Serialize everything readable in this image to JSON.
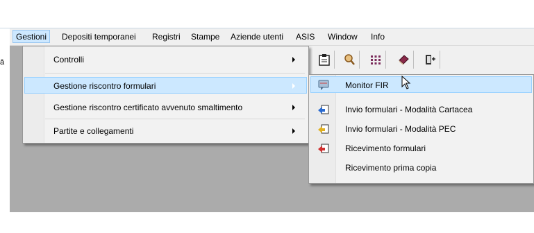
{
  "menubar": {
    "items": [
      {
        "label": "Gestioni"
      },
      {
        "label": "Depositi temporanei"
      },
      {
        "label": "Registri"
      },
      {
        "label": "Stampe"
      },
      {
        "label": "Aziende utenti"
      },
      {
        "label": "ASIS"
      },
      {
        "label": "Window"
      },
      {
        "label": "Info"
      }
    ]
  },
  "left_glyph": "ā",
  "menu": {
    "items": [
      {
        "label": "Controlli",
        "submenu": true
      },
      {
        "label": "Gestione riscontro formulari",
        "submenu": true,
        "highlighted": true
      },
      {
        "label": "Gestione riscontro certificato avvenuto smaltimento",
        "submenu": true
      },
      {
        "label": "Partite e collegamenti",
        "submenu": true
      }
    ]
  },
  "submenu": {
    "items": [
      {
        "label": "Monitor FIR",
        "icon": "monitor-chat-icon",
        "highlighted": true
      },
      {
        "label": "Invio formulari - Modalità Cartacea",
        "icon": "send-paper-icon"
      },
      {
        "label": "Invio formulari - Modalità PEC",
        "icon": "send-pec-icon"
      },
      {
        "label": "Ricevimento formulari",
        "icon": "receive-icon"
      },
      {
        "label": "Ricevimento prima copia",
        "icon": ""
      }
    ]
  },
  "toolbar": {
    "icons": [
      "clipboard-icon",
      "magnifier-map-icon",
      "grid-dots-icon",
      "book-icon",
      "exit-door-icon"
    ]
  },
  "colors": {
    "highlight": "#cce8ff",
    "highlight_border": "#99d1ff",
    "client_bg": "#ababab",
    "menu_bg": "#f2f2f2"
  }
}
